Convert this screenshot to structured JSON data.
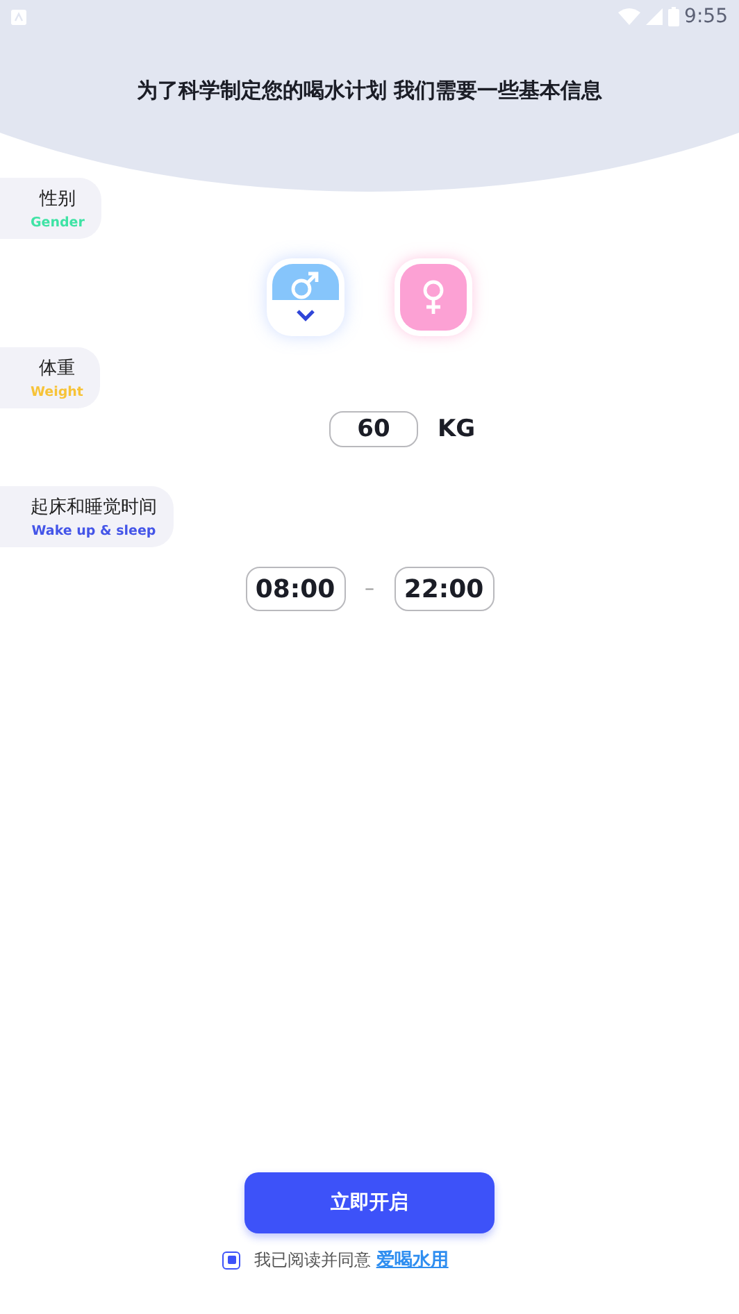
{
  "status_bar": {
    "time": "9:55"
  },
  "header": {
    "title": "为了科学制定您的喝水计划 我们需要一些基本信息"
  },
  "sections": [
    {
      "kind": "gender",
      "label": "性别",
      "sublabel": "Gender",
      "color": "#3fe3a5",
      "options": [
        {
          "kind": "male",
          "selected": true,
          "color": "#86c5fb"
        },
        {
          "kind": "female",
          "selected": false,
          "color": "#fca1d4"
        }
      ]
    },
    {
      "kind": "weight",
      "label": "体重",
      "sublabel": "Weight",
      "color": "#f7c338",
      "value": "60",
      "unit": "KG"
    },
    {
      "kind": "time",
      "label": "起床和睡觉时间",
      "sublabel": "Wake up & sleep",
      "color": "#4455e8",
      "wake": "08:00",
      "separator": "–",
      "sleep": "22:00"
    }
  ],
  "start_button": "立即开启",
  "agreement": {
    "checked": true,
    "text": "我已阅读并同意",
    "link": "爱喝水用"
  }
}
